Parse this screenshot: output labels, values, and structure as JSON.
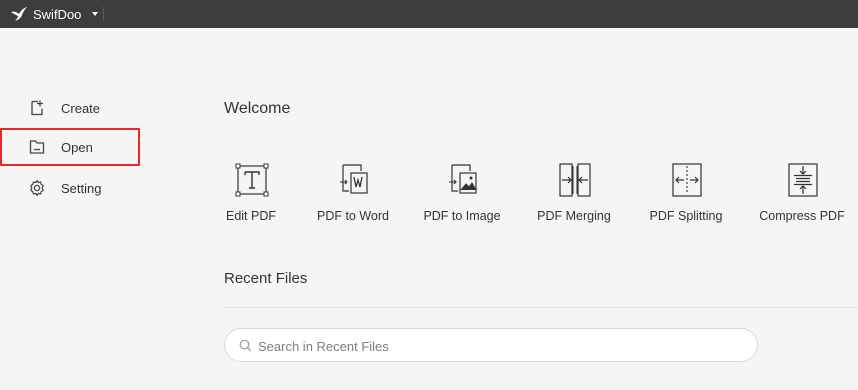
{
  "app": {
    "name": "SwifDoo"
  },
  "sidebar": {
    "items": [
      {
        "label": "Create",
        "icon": "create-file-icon"
      },
      {
        "label": "Open",
        "icon": "folder-open-icon",
        "highlighted": true
      },
      {
        "label": "Setting",
        "icon": "gear-icon"
      }
    ]
  },
  "main": {
    "welcome": "Welcome",
    "tools": [
      {
        "label": "Edit PDF",
        "icon": "edit-text-icon"
      },
      {
        "label": "PDF to Word",
        "icon": "pdf-to-word-icon"
      },
      {
        "label": "PDF to Image",
        "icon": "pdf-to-image-icon"
      },
      {
        "label": "PDF Merging",
        "icon": "merge-icon"
      },
      {
        "label": "PDF Splitting",
        "icon": "split-icon"
      },
      {
        "label": "Compress PDF",
        "icon": "compress-icon"
      }
    ],
    "recent_title": "Recent Files",
    "search": {
      "placeholder": "Search in Recent Files",
      "value": ""
    }
  },
  "colors": {
    "titlebar": "#3c3d3f",
    "highlight": "#e62727",
    "background": "#f5f5f5"
  }
}
